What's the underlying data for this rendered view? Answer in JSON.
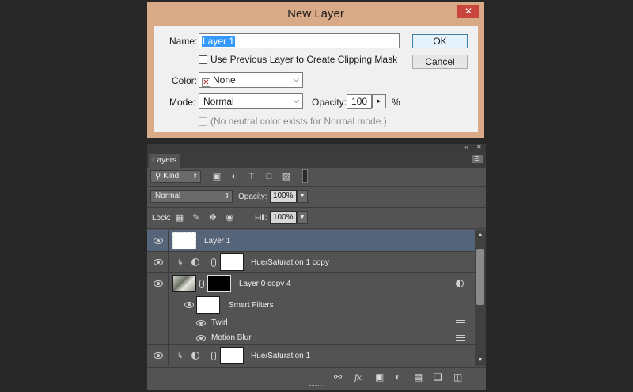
{
  "dialog": {
    "title": "New Layer",
    "close_label": "✕",
    "name_label": "Name:",
    "name_value": "Layer 1",
    "ok_label": "OK",
    "cancel_label": "Cancel",
    "clip_label": "Use Previous Layer to Create Clipping Mask",
    "clip_checked": false,
    "color_label": "Color:",
    "color_value": "None",
    "mode_label": "Mode:",
    "mode_value": "Normal",
    "opacity_label": "Opacity:",
    "opacity_value": "100",
    "opacity_unit": "%",
    "neutral_label": "(No neutral color exists for Normal mode.)",
    "neutral_checked": false
  },
  "panel": {
    "tab_label": "Layers",
    "kind_label": "Kind",
    "blend_mode": "Normal",
    "opacity_label": "Opacity:",
    "opacity_value": "100%",
    "lock_label": "Lock:",
    "fill_label": "Fill:",
    "fill_value": "100%",
    "layers": [
      {
        "name": "Layer 1",
        "selected": true
      },
      {
        "name": "Hue/Saturation 1 copy"
      },
      {
        "name": "Layer 0 copy 4"
      },
      {
        "name": "Smart Filters"
      },
      {
        "name": "Twirl"
      },
      {
        "name": "Motion Blur"
      },
      {
        "name": "Hue/Saturation 1"
      }
    ],
    "bottom_icons": [
      "link-icon",
      "fx-icon",
      "add-mask-icon",
      "adjustment-icon",
      "folder-icon",
      "new-layer-icon",
      "trash-icon"
    ]
  },
  "colors": {
    "dialog_frame": "#d8aa87",
    "selection": "#3399ff",
    "panel_bg": "#535353",
    "selected_row": "#56647a"
  }
}
